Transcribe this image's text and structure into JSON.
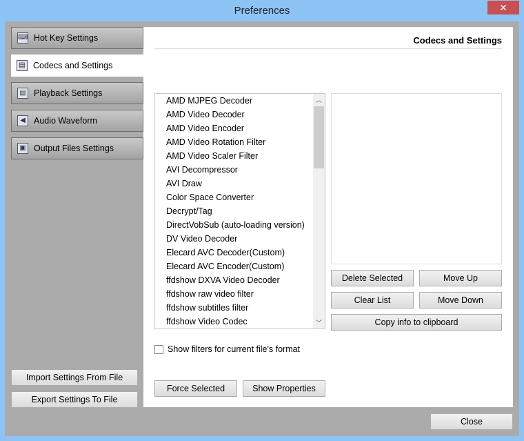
{
  "window": {
    "title": "Preferences",
    "close_glyph": "✕"
  },
  "nav": [
    {
      "label": "Hot Key Settings",
      "icon": "keyboard-icon",
      "glyph": "⌨"
    },
    {
      "label": "Codecs and Settings",
      "icon": "film-icon",
      "glyph": "▤"
    },
    {
      "label": "Playback Settings",
      "icon": "film-icon",
      "glyph": "▤"
    },
    {
      "label": "Audio Waveform",
      "icon": "speaker-icon",
      "glyph": "◀"
    },
    {
      "label": "Output Files Settings",
      "icon": "floppy-icon",
      "glyph": "▣"
    }
  ],
  "import_label": "Import Settings From File",
  "export_label": "Export Settings To File",
  "panel": {
    "title": "Codecs and Settings",
    "filters": [
      "AMD MJPEG Decoder",
      "AMD Video Decoder",
      "AMD Video Encoder",
      "AMD Video Rotation Filter",
      "AMD Video Scaler Filter",
      "AVI Decompressor",
      "AVI Draw",
      "Color Space Converter",
      "Decrypt/Tag",
      "DirectVobSub (auto-loading version)",
      "DV Video Decoder",
      "Elecard AVC Decoder(Custom)",
      "Elecard AVC Encoder(Custom)",
      "ffdshow DXVA Video Decoder",
      "ffdshow raw video filter",
      "ffdshow subtitles filter",
      "ffdshow Video Codec"
    ],
    "delete_selected": "Delete Selected",
    "move_up": "Move Up",
    "clear_list": "Clear List",
    "move_down": "Move Down",
    "copy_info": "Copy info to clipboard",
    "show_filters": "Show filters for current file's format",
    "force_selected": "Force Selected",
    "show_properties": "Show Properties"
  },
  "close_label": "Close"
}
